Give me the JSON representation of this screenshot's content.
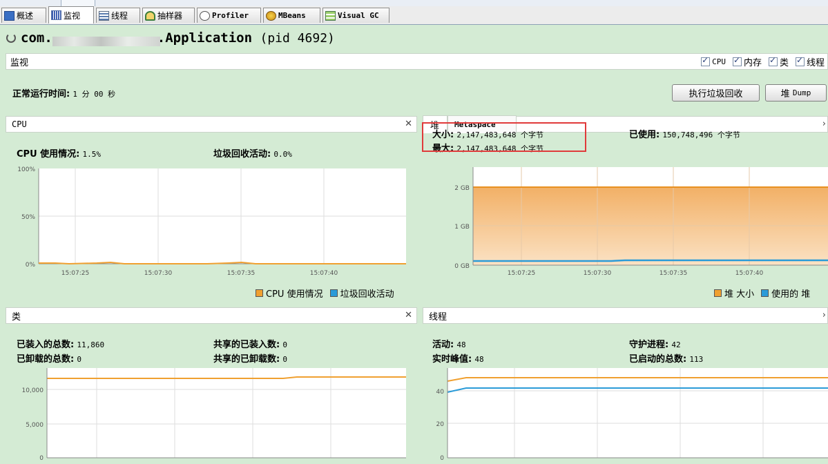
{
  "tabs": [
    {
      "label": "概述",
      "icon": "overview-icon"
    },
    {
      "label": "监视",
      "icon": "monitor-icon"
    },
    {
      "label": "线程",
      "icon": "threads-icon"
    },
    {
      "label": "抽样器",
      "icon": "sampler-icon"
    },
    {
      "label": "Profiler",
      "icon": "profiler-icon"
    },
    {
      "label": "MBeans",
      "icon": "mbeans-icon"
    },
    {
      "label": "Visual GC",
      "icon": "visual-gc-icon"
    }
  ],
  "app": {
    "prefix": "com.",
    "name": ".Application",
    "pid": "(pid 4692)"
  },
  "monitor": {
    "title": "监视",
    "checkboxes": [
      {
        "label": "CPU",
        "checked": true
      },
      {
        "label": "内存",
        "checked": true
      },
      {
        "label": "类",
        "checked": true
      },
      {
        "label": "线程",
        "checked": true
      }
    ],
    "uptime_label": "正常运行时间:",
    "uptime_value": "1 分 00 秒",
    "gc_button": "执行垃圾回收",
    "heap_dump_button_a": "堆",
    "heap_dump_button_b": "Dump"
  },
  "cpu": {
    "title": "CPU",
    "usage_label": "CPU 使用情况:",
    "usage_value": "1.5%",
    "gc_label": "垃圾回收活动:",
    "gc_value": "0.0%",
    "y_ticks": [
      "100%",
      "50%",
      "0%"
    ],
    "x_ticks": [
      "15:07:25",
      "15:07:30",
      "15:07:35",
      "15:07:40"
    ],
    "legend": [
      {
        "label": "CPU 使用情况",
        "color": "#f0a030"
      },
      {
        "label": "垃圾回收活动",
        "color": "#2a9bd8"
      }
    ]
  },
  "heap": {
    "tab_heap": "堆",
    "tab_meta": "Metaspace",
    "size_label": "大小:",
    "size_value": "2,147,483,648 个字节",
    "max_label": "最大:",
    "max_value": "2,147,483,648 个字节",
    "used_label": "已使用:",
    "used_value": "150,748,496 个字节",
    "y_ticks": [
      "2 GB",
      "1 GB",
      "0 GB"
    ],
    "x_ticks": [
      "15:07:25",
      "15:07:30",
      "15:07:35",
      "15:07:40"
    ],
    "legend": [
      {
        "label": "堆 大小",
        "color": "#f0a030"
      },
      {
        "label": "使用的 堆",
        "color": "#2a9bd8"
      }
    ]
  },
  "classes": {
    "title": "类",
    "loaded_label": "已装入的总数:",
    "loaded_value": "11,860",
    "unloaded_label": "已卸载的总数:",
    "unloaded_value": "0",
    "shared_loaded_label": "共享的已装入数:",
    "shared_loaded_value": "0",
    "shared_unloaded_label": "共享的已卸载数:",
    "shared_unloaded_value": "0",
    "y_ticks": [
      "10,000",
      "5,000",
      "0"
    ]
  },
  "threads": {
    "title": "线程",
    "live_label": "活动:",
    "live_value": "48",
    "peak_label": "实时峰值:",
    "peak_value": "48",
    "daemon_label": "守护进程:",
    "daemon_value": "42",
    "started_label": "已启动的总数:",
    "started_value": "113",
    "y_ticks": [
      "40",
      "20",
      "0"
    ]
  },
  "colors": {
    "orange": "#f0a030",
    "blue": "#2a9bd8",
    "background": "#d4ebd4"
  }
}
